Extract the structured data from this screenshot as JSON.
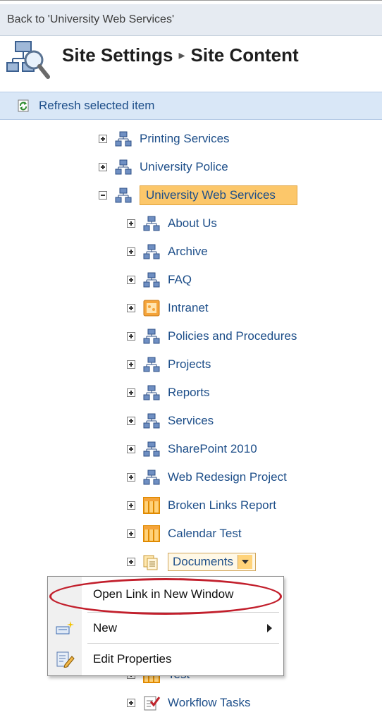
{
  "header": {
    "back_link": "Back to 'University Web Services'",
    "title_part1": "Site Settings",
    "title_sep": "▸",
    "title_part2": "Site Content"
  },
  "toolbar": {
    "refresh_label": "Refresh selected item"
  },
  "tree": {
    "items": [
      {
        "label": "Printing Services"
      },
      {
        "label": "University Police"
      },
      {
        "label": "University Web Services"
      },
      {
        "label": "About Us"
      },
      {
        "label": "Archive"
      },
      {
        "label": "FAQ"
      },
      {
        "label": "Intranet"
      },
      {
        "label": "Policies and Procedures"
      },
      {
        "label": "Projects"
      },
      {
        "label": "Reports"
      },
      {
        "label": "Services"
      },
      {
        "label": "SharePoint 2010"
      },
      {
        "label": "Web Redesign Project"
      },
      {
        "label": "Broken Links Report"
      },
      {
        "label": "Calendar Test"
      },
      {
        "label": "Documents"
      },
      {
        "label": "Test"
      },
      {
        "label": "Workflow Tasks"
      }
    ]
  },
  "context_menu": {
    "items": [
      {
        "label": "Open Link in New Window"
      },
      {
        "label": "New"
      },
      {
        "label": "Edit Properties"
      }
    ]
  },
  "colors": {
    "selected_bg": "#fcc76a",
    "toolbar_bg": "#d9e7f7",
    "highlight_ring": "#c21f2c"
  }
}
